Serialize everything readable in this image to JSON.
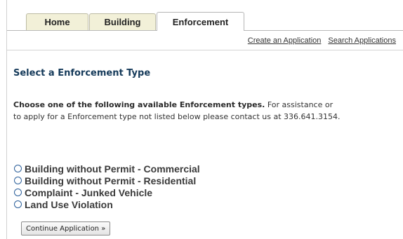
{
  "tabs": [
    {
      "label": "Home"
    },
    {
      "label": "Building"
    },
    {
      "label": "Enforcement",
      "active": true
    }
  ],
  "subnav": {
    "create": "Create an Application",
    "search": "Search Applications"
  },
  "page": {
    "heading": "Select a Enforcement Type",
    "instructions_bold": "Choose one of the following available Enforcement types.",
    "instructions_line1_rest": " For assistance or",
    "instructions_line2": "to apply for a Enforcement type not listed below please contact us at 336.641.3154."
  },
  "options": [
    {
      "label": "Building without Permit - Commercial",
      "selected": false
    },
    {
      "label": "Building without Permit - Residential",
      "selected": false
    },
    {
      "label": "Complaint - Junked Vehicle",
      "selected": false
    },
    {
      "label": "Land Use Violation",
      "selected": false
    }
  ],
  "continue_button": {
    "label": "Continue Application »"
  }
}
